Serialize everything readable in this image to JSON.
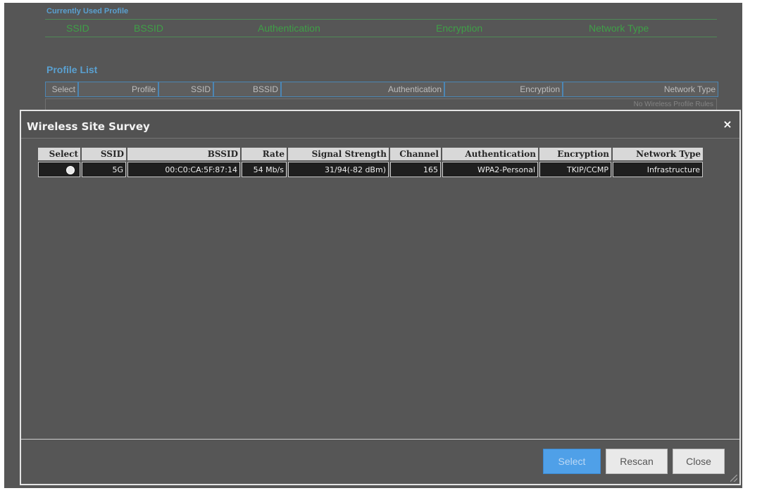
{
  "background": {
    "current_profile": {
      "title": "Currently Used Profile",
      "columns": [
        "SSID",
        "BSSID",
        "Authentication",
        "Encryption",
        "Network Type"
      ]
    },
    "profile_list": {
      "title": "Profile List",
      "columns": [
        "Select",
        "Profile",
        "SSID",
        "BSSID",
        "Authentication",
        "Encryption",
        "Network Type"
      ],
      "empty_text": "No Wireless Profile Rules"
    }
  },
  "dialog": {
    "title": "Wireless Site Survey",
    "close_glyph": "×",
    "table": {
      "columns": [
        "Select",
        "SSID",
        "BSSID",
        "Rate",
        "Signal Strength",
        "Channel",
        "Authentication",
        "Encryption",
        "Network Type"
      ],
      "rows": [
        {
          "ssid": "5G",
          "bssid": "00:C0:CA:5F:87:14",
          "rate": "54 Mb/s",
          "signal": "31/94(-82 dBm)",
          "channel": "165",
          "auth": "WPA2-Personal",
          "encryption": "TKIP/CCMP",
          "network_type": "Infrastructure"
        }
      ]
    },
    "buttons": {
      "select": "Select",
      "rescan": "Rescan",
      "close": "Close"
    }
  },
  "colors": {
    "background": "#565656",
    "accent_blue": "#4fa0e8",
    "profile_green": "#3f9f47"
  },
  "icons": {
    "close": "close-icon",
    "radio": "radio-button",
    "resize": "resize-grip-icon"
  }
}
